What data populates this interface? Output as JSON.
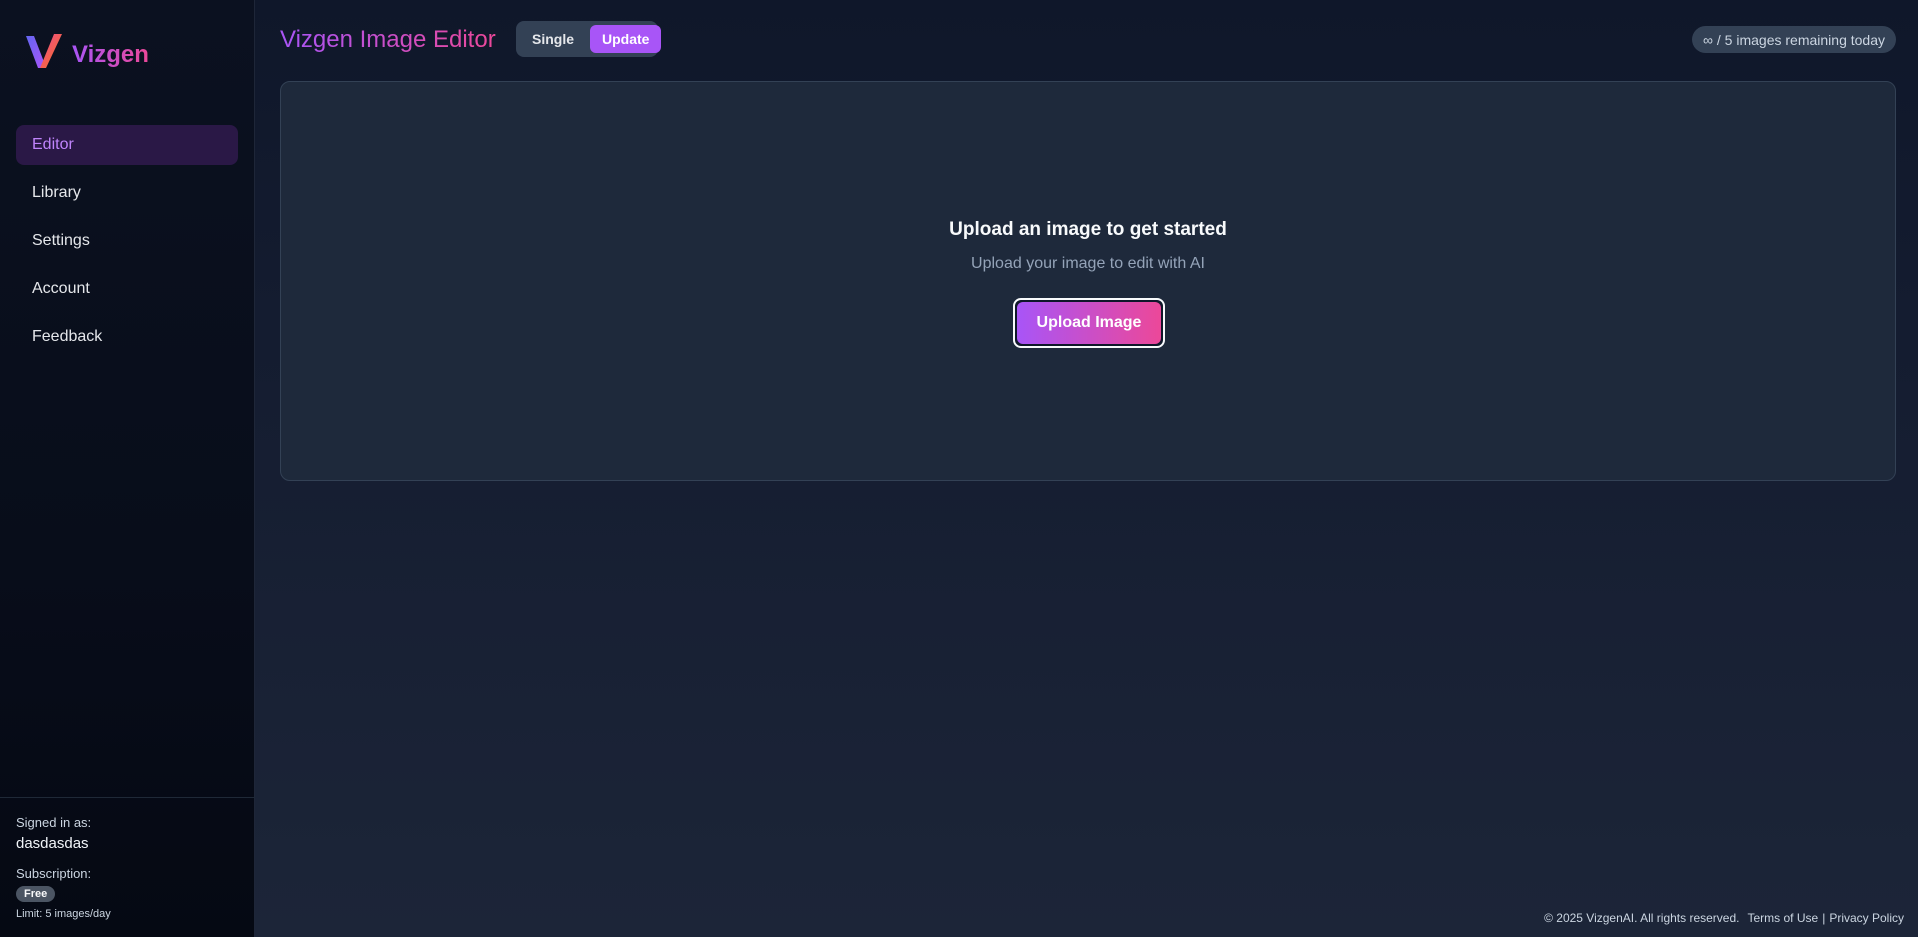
{
  "brand": {
    "name": "Vizgen",
    "logo_icon": "v-logo-icon",
    "gradient_start": "#a855f7",
    "gradient_end": "#ec4899"
  },
  "sidebar": {
    "items": [
      {
        "label": "Editor",
        "active": true
      },
      {
        "label": "Library",
        "active": false
      },
      {
        "label": "Settings",
        "active": false
      },
      {
        "label": "Account",
        "active": false
      },
      {
        "label": "Feedback",
        "active": false
      }
    ],
    "user": {
      "signed_in_label": "Signed in as:",
      "username": "dasdasdas",
      "subscription_label": "Subscription:",
      "plan_badge": "Free",
      "limit_text": "Limit: 5 images/day"
    }
  },
  "header": {
    "title": "Vizgen Image Editor",
    "modes": [
      {
        "label": "Single",
        "active": false
      },
      {
        "label": "Update",
        "active": true
      }
    ],
    "quota": "∞ / 5 images remaining today"
  },
  "upload": {
    "title": "Upload an image to get started",
    "subtitle": "Upload your image to edit with AI",
    "button_label": "Upload Image"
  },
  "footer": {
    "copyright": "© 2025 VizgenAI. All rights reserved.",
    "terms": "Terms of Use",
    "separator": "|",
    "privacy": "Privacy Policy"
  }
}
